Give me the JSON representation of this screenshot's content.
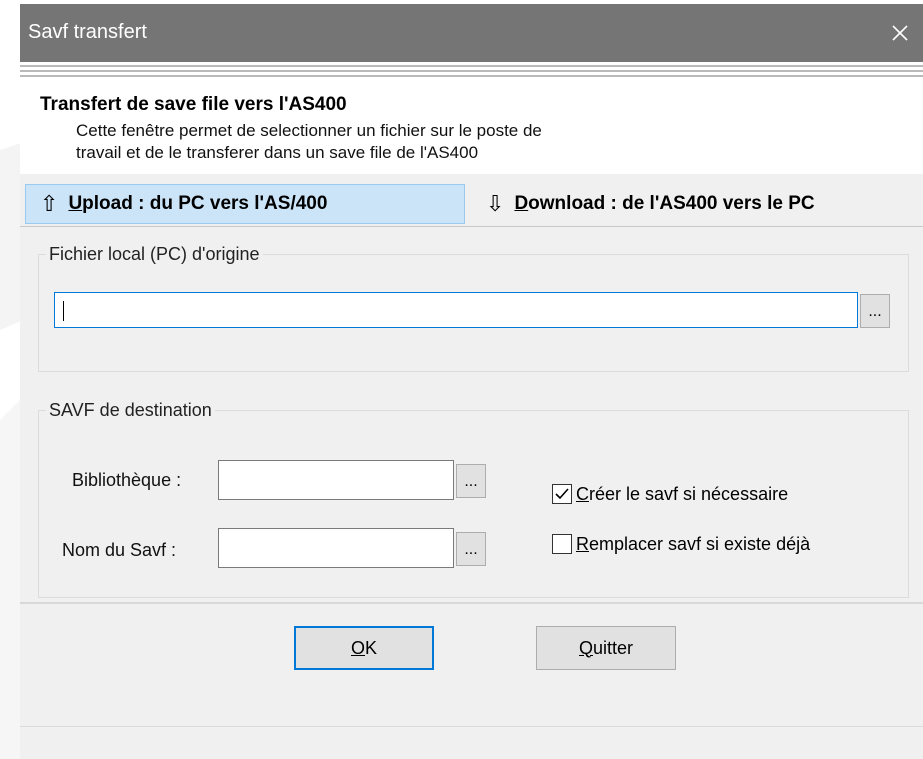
{
  "window": {
    "title": "Savf transfert",
    "close_glyph": "✕"
  },
  "header": {
    "title": "Transfert de save file vers l'AS400",
    "description_line1": "Cette fenêtre permet de selectionner un fichier sur le poste de",
    "description_line2": "travail et de le transferer dans un save file de l'AS400"
  },
  "tabs": [
    {
      "arrow": "⇧",
      "hotkey": "U",
      "rest": "pload : du PC vers l'AS/400",
      "active": true
    },
    {
      "arrow": "⇩",
      "hotkey": "D",
      "rest": "ownload : de l'AS400 vers le PC",
      "active": false
    }
  ],
  "source_group": {
    "legend": "Fichier local (PC) d'origine",
    "file_value": "",
    "browse_label": "..."
  },
  "dest_group": {
    "legend": "SAVF de destination",
    "library_label": "Bibliothèque :",
    "library_value": "",
    "savf_label": "Nom du Savf :",
    "savf_value": "",
    "browse_label": "...",
    "create_checkbox": {
      "hotkey": "C",
      "rest": "réer le savf si nécessaire",
      "checked": true
    },
    "replace_checkbox": {
      "hotkey": "R",
      "rest": "emplacer savf si existe déjà",
      "checked": false
    }
  },
  "buttons": {
    "ok": {
      "hotkey": "O",
      "rest": "K"
    },
    "quit": {
      "hotkey": "Q",
      "rest": "uitter"
    }
  },
  "colors": {
    "titlebar": "#757575",
    "active_tab": "#cce4f7",
    "focus_border": "#0078d7"
  }
}
